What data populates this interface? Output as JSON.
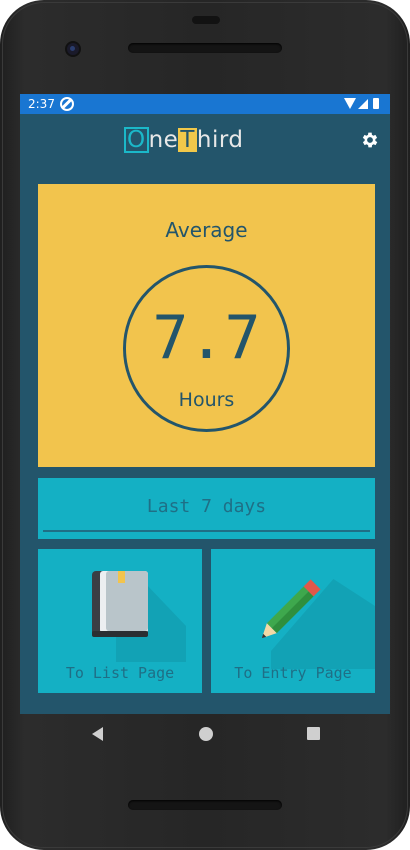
{
  "status_bar": {
    "time": "2:37"
  },
  "app_bar": {
    "logo_parts": [
      "O",
      "ne",
      "T",
      "hird"
    ],
    "settings_icon": "gear-icon"
  },
  "summary": {
    "label": "Average",
    "value": "7.7",
    "unit": "Hours"
  },
  "period": {
    "selected": "Last 7 days"
  },
  "navigation": {
    "list": {
      "label": "To List Page",
      "icon": "book-icon"
    },
    "entry": {
      "label": "To Entry Page",
      "icon": "pencil-icon"
    }
  },
  "colors": {
    "background": "#23556b",
    "accent_yellow": "#f2c44d",
    "accent_teal": "#14b0c4",
    "status_bar": "#1976d2"
  }
}
